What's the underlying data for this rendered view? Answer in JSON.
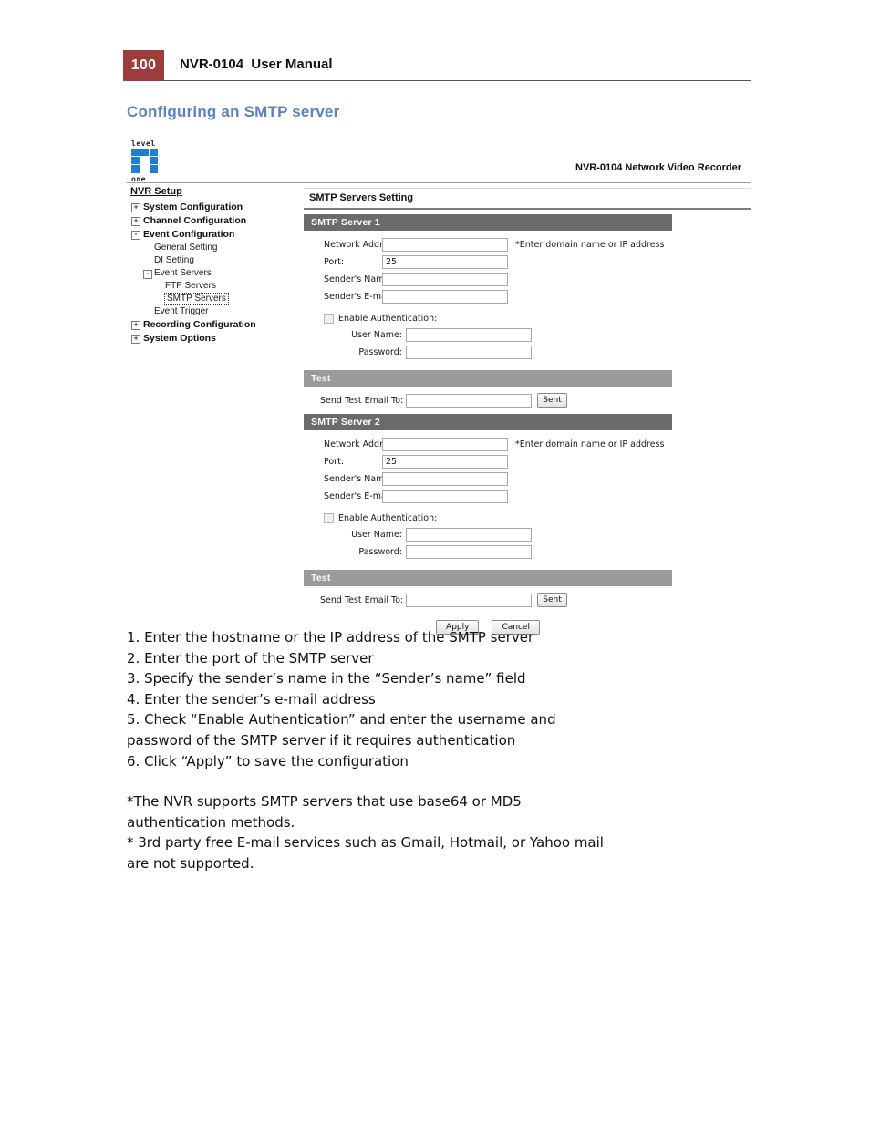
{
  "page": {
    "number": "100",
    "manual_title": "NVR-0104  User Manual",
    "section_heading": "Configuring an SMTP server"
  },
  "device_ui": {
    "logo": {
      "top_word": "level",
      "bottom_word": "one",
      "color": "#1c7fd4"
    },
    "product_title": "NVR-0104 Network Video Recorder",
    "sidebar": {
      "root_label": "NVR Setup",
      "items": [
        {
          "label": "System Configuration",
          "level": 1,
          "expander": "+"
        },
        {
          "label": "Channel Configuration",
          "level": 1,
          "expander": "+"
        },
        {
          "label": "Event Configuration",
          "level": 1,
          "expander": "-"
        },
        {
          "label": "General Setting",
          "level": 2,
          "expander": ""
        },
        {
          "label": "DI Setting",
          "level": 2,
          "expander": ""
        },
        {
          "label": "Event Servers",
          "level": 2,
          "expander": "-"
        },
        {
          "label": "FTP Servers",
          "level": 3,
          "selected": false
        },
        {
          "label": "SMTP Servers",
          "level": 3,
          "selected": true
        },
        {
          "label": "Event Trigger",
          "level": 2,
          "expander": ""
        },
        {
          "label": "Recording Configuration",
          "level": 1,
          "expander": "+"
        },
        {
          "label": "System Options",
          "level": 1,
          "expander": "+"
        }
      ]
    },
    "panel": {
      "title": "SMTP Servers Setting",
      "colors": {
        "server_bar": "#6b6b6b",
        "test_bar": "#9a9a9a"
      },
      "servers": [
        {
          "bar_label": "SMTP Server 1",
          "fields": {
            "network_address_label": "Network Address:",
            "network_address_value": "",
            "network_address_hint": "*Enter domain name or IP address",
            "port_label": "Port:",
            "port_value": "25",
            "sender_name_label": "Sender's Name:",
            "sender_name_value": "",
            "sender_email_label": "Sender's E-mail:",
            "sender_email_value": "",
            "enable_auth_label": "Enable Authentication:",
            "enable_auth_checked": false,
            "user_name_label": "User Name:",
            "user_name_value": "",
            "password_label": "Password:",
            "password_value": ""
          },
          "test": {
            "bar_label": "Test",
            "send_label": "Send Test Email To:",
            "send_value": "",
            "send_button": "Sent"
          }
        },
        {
          "bar_label": "SMTP Server 2",
          "fields": {
            "network_address_label": "Network Address:",
            "network_address_value": "",
            "network_address_hint": "*Enter domain name or IP address",
            "port_label": "Port:",
            "port_value": "25",
            "sender_name_label": "Sender's Name:",
            "sender_name_value": "",
            "sender_email_label": "Sender's E-mail:",
            "sender_email_value": "",
            "enable_auth_label": "Enable Authentication:",
            "enable_auth_checked": false,
            "user_name_label": "User Name:",
            "user_name_value": "",
            "password_label": "Password:",
            "password_value": ""
          },
          "test": {
            "bar_label": "Test",
            "send_label": "Send Test Email To:",
            "send_value": "",
            "send_button": "Sent"
          }
        }
      ],
      "actions": {
        "apply": "Apply",
        "cancel": "Cancel"
      }
    }
  },
  "instructions": {
    "steps": [
      "1. Enter the hostname or the IP address of the SMTP server",
      "2. Enter the port of the SMTP server",
      "3. Specify the sender’s name in the “Sender’s name” field",
      "4. Enter the sender’s e-mail address",
      "5. Check “Enable Authentication” and enter the username and",
      "password of the SMTP server if it requires authentication",
      "6. Click “Apply” to save the configuration"
    ],
    "notes": [
      "*The NVR supports SMTP servers that use base64 or MD5",
      "authentication methods.",
      "* 3rd party free E-mail services such as Gmail, Hotmail, or Yahoo mail",
      "are not supported."
    ]
  }
}
